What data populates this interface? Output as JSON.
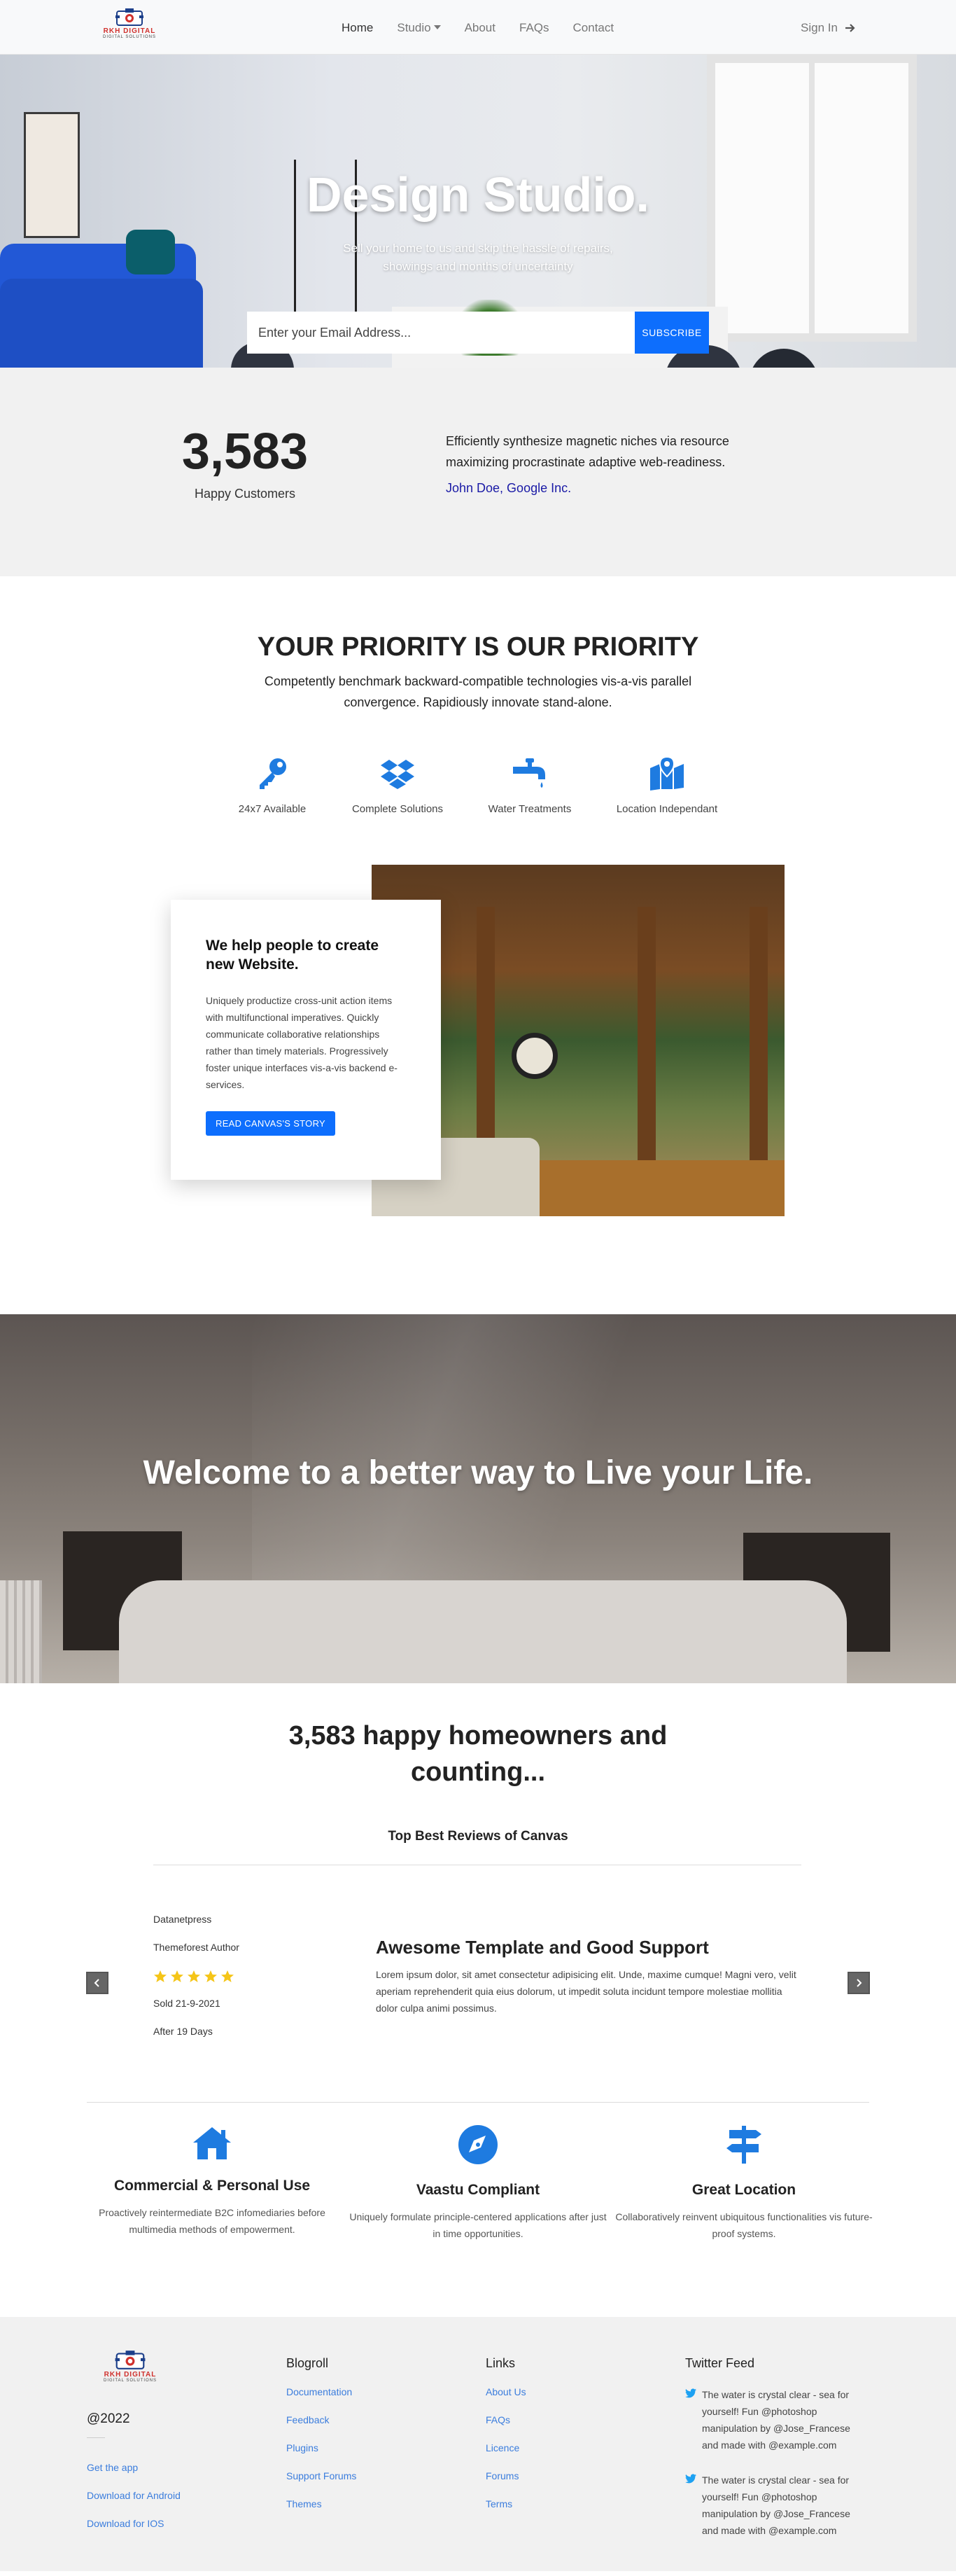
{
  "nav": {
    "logo_text": "RKH DIGITAL",
    "logo_sub": "DIGITAL SOLUTIONS",
    "items": [
      {
        "label": "Home"
      },
      {
        "label": "Studio"
      },
      {
        "label": "About"
      },
      {
        "label": "FAQs"
      },
      {
        "label": "Contact"
      }
    ],
    "signin": "Sign In"
  },
  "hero": {
    "title": "Design Studio.",
    "subtitle": "Sell your home to us and skip the hassle of repairs, showings and months of uncertainty",
    "email_placeholder": "Enter your Email Address...",
    "subscribe_label": "SUBSCRIBE"
  },
  "stats": {
    "count": "3,583",
    "count_label": "Happy Customers",
    "quote": "Efficiently synthesize magnetic niches via resource maximizing procrastinate adaptive web-readiness.",
    "author": "John Doe, Google Inc."
  },
  "priority": {
    "title": "YOUR PRIORITY IS OUR PRIORITY",
    "text": "Competently benchmark backward-compatible technologies vis-a-vis parallel convergence. Rapidiously innovate stand-alone.",
    "features": [
      {
        "label": "24x7 Available",
        "icon": "key-icon"
      },
      {
        "label": "Complete Solutions",
        "icon": "dropbox-icon"
      },
      {
        "label": "Water Treatments",
        "icon": "faucet-icon"
      },
      {
        "label": "Location Independant",
        "icon": "map-location-icon"
      }
    ],
    "card": {
      "title": "We help people to create new Website.",
      "text": "Uniquely productize cross-unit action items with multifunctional imperatives. Quickly communicate collaborative relationships rather than timely materials. Progressively foster unique interfaces vis-a-vis backend e-services.",
      "button": "READ CANVAS'S STORY"
    }
  },
  "banner": {
    "title": "Welcome to a better way to Live your Life."
  },
  "reviews": {
    "title": "3,583 happy homeowners and counting...",
    "subtitle": "Top Best Reviews of Canvas",
    "review": {
      "author": "Datanetpress",
      "role": "Themeforest Author",
      "rating": 5,
      "sold": "Sold 21-9-2021",
      "after": "After 19 Days",
      "heading": "Awesome Template and Good Support",
      "body": "Lorem ipsum dolor, sit amet consectetur adipisicing elit. Unde, maxime cumque! Magni vero, velit aperiam reprehenderit quia eius dolorum, ut impedit soluta incidunt tempore molestiae mollitia dolor culpa animi possimus."
    }
  },
  "services": [
    {
      "title": "Commercial & Personal Use",
      "text": "Proactively reintermediate B2C infomediaries before multimedia methods of empowerment.",
      "icon": "home-icon"
    },
    {
      "title": "Vaastu Compliant",
      "text": "Uniquely formulate principle-centered applications after just in time opportunities.",
      "icon": "compass-icon"
    },
    {
      "title": "Great Location",
      "text": "Collaboratively reinvent ubiquitous functionalities vis future-proof systems.",
      "icon": "signpost-icon"
    }
  ],
  "footer": {
    "copyright": "@2022",
    "apps": [
      "Get the app",
      "Download for Android",
      "Download for IOS"
    ],
    "blogroll": {
      "title": "Blogroll",
      "links": [
        "Documentation",
        "Feedback",
        "Plugins",
        "Support Forums",
        "Themes"
      ]
    },
    "links": {
      "title": "Links",
      "links": [
        "About Us",
        "FAQs",
        "Licence",
        "Forums",
        "Terms"
      ]
    },
    "twitter": {
      "title": "Twitter Feed",
      "tweets": [
        "The water is crystal clear - sea for yourself! Fun @photoshop manipulation by @Jose_Francese and made with @example.com",
        "The water is crystal clear - sea for yourself! Fun @photoshop manipulation by @Jose_Francese and made with @example.com"
      ]
    }
  },
  "colors": {
    "accent": "#0d6efd",
    "icon_blue": "#1e7be0",
    "link": "#3b7ddd",
    "star": "#f5c518",
    "logo_red": "#d0312d"
  }
}
